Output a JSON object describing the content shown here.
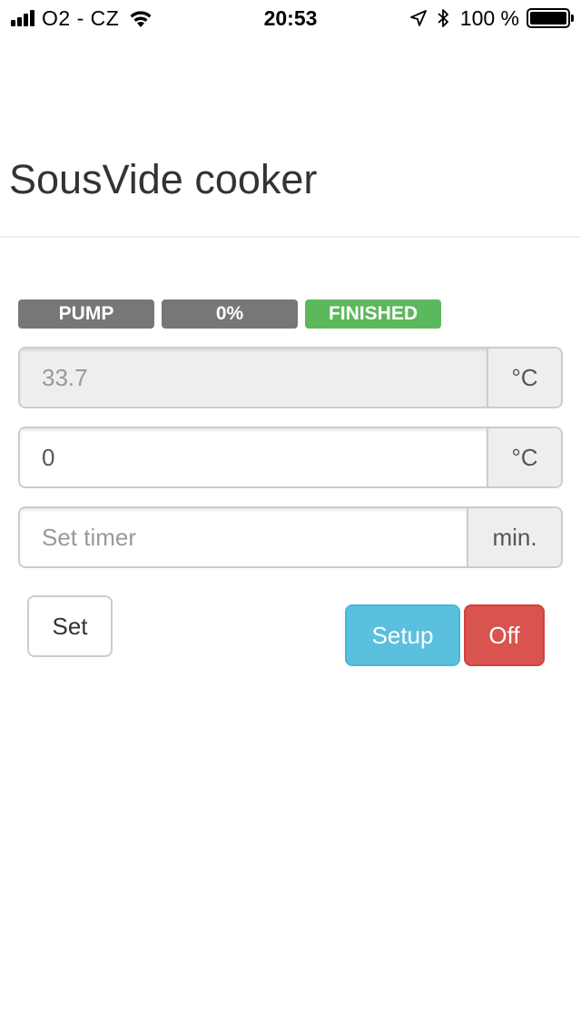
{
  "status_bar": {
    "carrier": "O2 - CZ",
    "time": "20:53",
    "battery": "100 %",
    "icons": [
      "signal-icon",
      "wifi-icon",
      "location-icon",
      "bluetooth-icon",
      "battery-icon"
    ]
  },
  "header": {
    "title": "SousVide cooker"
  },
  "labels": {
    "pump": "PUMP",
    "power": "0%",
    "state": "FINISHED"
  },
  "current_temp": {
    "value": "33.7",
    "unit": "°C"
  },
  "target_temp": {
    "value": "0",
    "unit": "°C"
  },
  "timer": {
    "value": "",
    "placeholder": "Set timer",
    "unit": "min."
  },
  "buttons": {
    "set": "Set",
    "setup": "Setup",
    "off": "Off"
  },
  "colors": {
    "label_default": "#777777",
    "label_success": "#5cb85c",
    "info": "#5bc0de",
    "danger": "#d9534f"
  }
}
